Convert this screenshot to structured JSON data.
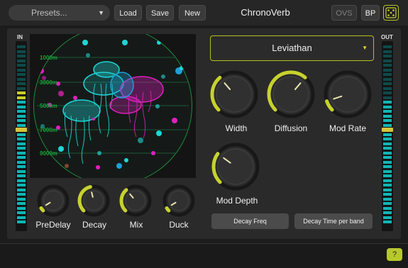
{
  "toolbar": {
    "presets_label": "Presets...",
    "load_label": "Load",
    "save_label": "Save",
    "new_label": "New",
    "title": "ChronoVerb",
    "ovs_label": "OVS",
    "bp_label": "BP"
  },
  "meters": {
    "in_label": "IN",
    "out_label": "OUT"
  },
  "viz": {
    "depth_labels": [
      "1000m",
      "3000m",
      "5000m",
      "7000m",
      "9000m"
    ]
  },
  "algorithm": {
    "selected": "Leviathan"
  },
  "knobs": {
    "width": {
      "label": "Width",
      "value": 0.35
    },
    "diffusion": {
      "label": "Diffusion",
      "value": 0.65
    },
    "mod_rate": {
      "label": "Mod Rate",
      "value": 0.1
    },
    "mod_depth": {
      "label": "Mod Depth",
      "value": 0.3
    },
    "predelay": {
      "label": "PreDelay",
      "value": 0.05
    },
    "decay": {
      "label": "Decay",
      "value": 0.45
    },
    "mix": {
      "label": "Mix",
      "value": 0.35
    },
    "duck": {
      "label": "Duck",
      "value": 0.05
    }
  },
  "buttons": {
    "decay_freq": "Decay Freq",
    "decay_time_per_band": "Decay Time per band"
  },
  "help_label": "?",
  "colors": {
    "accent": "#c7d22e",
    "meter_cyan": "#11b5b5",
    "viz_cyan": "#1fd6d6",
    "viz_magenta": "#e020c0"
  }
}
